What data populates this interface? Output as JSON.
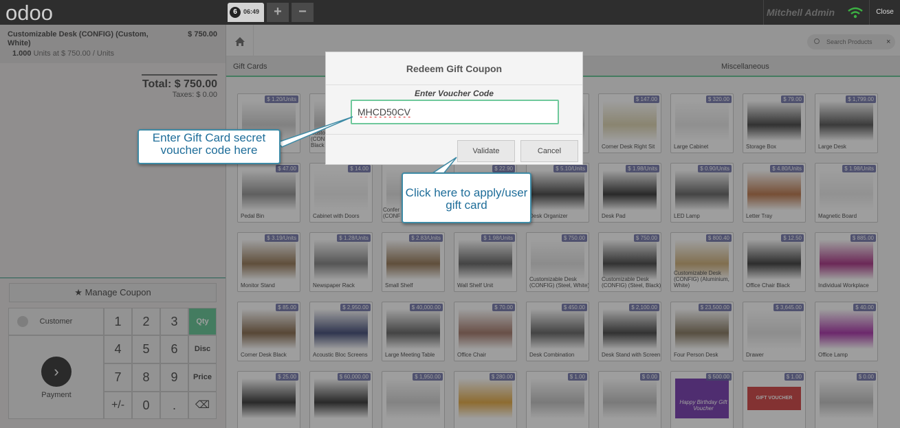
{
  "header": {
    "logo_text": "odoo",
    "order_number": "6",
    "order_time": "06:49",
    "add_order_symbol": "+",
    "remove_order_symbol": "−",
    "user_name": "Mitchell Admin",
    "wifi_icon": "wifi-icon",
    "close_label": "Close"
  },
  "order": {
    "line": {
      "product": "Customizable Desk (CONFIG) (Custom, White)",
      "price": "$ 750.00",
      "qty": "1.000",
      "qty_detail": "Units at $ 750.00 / Units"
    },
    "total": "Total: $ 750.00",
    "taxes": "Taxes: $ 0.00"
  },
  "controls": {
    "manage_coupon": "★ Manage Coupon",
    "customer": "Customer",
    "payment": "Payment",
    "payment_icon": "›",
    "digits": [
      "1",
      "2",
      "3",
      "4",
      "5",
      "6",
      "7",
      "8",
      "9",
      "+/-",
      "0",
      "."
    ],
    "modes": [
      "Qty",
      "Disc",
      "Price"
    ],
    "backspace_icon": "⌫",
    "active_mode_color": "#6ec89b"
  },
  "products_area": {
    "search_placeholder": "Search Products",
    "search_clear": "×",
    "categories": [
      "Gift Cards",
      "Miscellaneous"
    ],
    "products": [
      {
        "name": "",
        "price": "$ 1.20/Units"
      },
      {
        "name": "",
        "price": ""
      },
      {
        "name": "",
        "price": ""
      },
      {
        "name": "",
        "price": ""
      },
      {
        "name": "",
        "price": ""
      },
      {
        "name": "Corner Desk Right Sit",
        "price": "$ 147.00"
      },
      {
        "name": "Large Cabinet",
        "price": "$ 320.00"
      },
      {
        "name": "Storage Box",
        "price": "$ 79.00"
      },
      {
        "name": "Large Desk",
        "price": "$ 1,799.00"
      },
      {
        "name": "Pedal Bin",
        "price": "$ 47.00"
      },
      {
        "name": "Cabinet with Doors",
        "price": "$ 14.00"
      },
      {
        "name": "",
        "price": ""
      },
      {
        "name": "",
        "price": "$ 22.90"
      },
      {
        "name": "Desk Organizer",
        "price": "$ 5.10/Units"
      },
      {
        "name": "Desk Pad",
        "price": "$ 1.98/Units"
      },
      {
        "name": "LED Lamp",
        "price": "$ 0.90/Units"
      },
      {
        "name": "Letter Tray",
        "price": "$ 4.80/Units"
      },
      {
        "name": "Magnetic Board",
        "price": "$ 1.98/Units"
      },
      {
        "name": "Monitor Stand",
        "price": "$ 3.19/Units"
      },
      {
        "name": "Newspaper Rack",
        "price": "$ 1.28/Units"
      },
      {
        "name": "Small Shelf",
        "price": "$ 2.83/Units"
      },
      {
        "name": "Wall Shelf Unit",
        "price": "$ 1.98/Units"
      },
      {
        "name": "Customizable Desk (CONFIG) (Steel, White)",
        "price": "$ 750.00"
      },
      {
        "name": "Customizable Desk (CONFIG) (Steel, Black)",
        "price": "$ 750.00"
      },
      {
        "name": "Customizable Desk (CONFIG) (Aluminium, White)",
        "price": "$ 800.40"
      },
      {
        "name": "Office Chair Black",
        "price": "$ 12.50"
      },
      {
        "name": "Individual Workplace",
        "price": "$ 885.00"
      },
      {
        "name": "Corner Desk Black",
        "price": "$ 85.00"
      },
      {
        "name": "Acoustic Bloc Screens",
        "price": "$ 2,950.00"
      },
      {
        "name": "Large Meeting Table",
        "price": "$ 40,000.00"
      },
      {
        "name": "Office Chair",
        "price": "$ 70.00"
      },
      {
        "name": "Desk Combination",
        "price": "$ 450.00"
      },
      {
        "name": "Desk Stand with Screen",
        "price": "$ 2,100.00"
      },
      {
        "name": "Four Person Desk",
        "price": "$ 23,500.00"
      },
      {
        "name": "Drawer",
        "price": "$ 3,645.00"
      },
      {
        "name": "Office Lamp",
        "price": "$ 40.00"
      },
      {
        "name": "",
        "price": "$ 25.00"
      },
      {
        "name": "",
        "price": "$ 60,000.00"
      },
      {
        "name": "",
        "price": "$ 1,950.00"
      },
      {
        "name": "",
        "price": "$ 280.00"
      },
      {
        "name": "",
        "price": "$ 1.00"
      },
      {
        "name": "",
        "price": "$ 0.00"
      },
      {
        "name": "",
        "price": "$ 500.00"
      },
      {
        "name": "",
        "price": "$ 1.00"
      },
      {
        "name": "",
        "price": "$ 0.00"
      }
    ],
    "partial_name_fragments": [
      "Custo",
      "(CONF",
      "Black",
      "Confer",
      "(CONF"
    ],
    "image_texts": [
      "Happy Birthday",
      "Gift Voucher",
      "GIFT VOUCHER"
    ]
  },
  "modal": {
    "title": "Redeem Gift Coupon",
    "field_label": "Enter Voucher Code",
    "voucher_value": "MHCD50CV",
    "validate_label": "Validate",
    "cancel_label": "Cancel"
  },
  "callouts": {
    "voucher_hint": "Enter Gift Card secret voucher code here",
    "validate_hint": "Click here to apply/user gift card",
    "accent_color": "#3d8aa5"
  }
}
